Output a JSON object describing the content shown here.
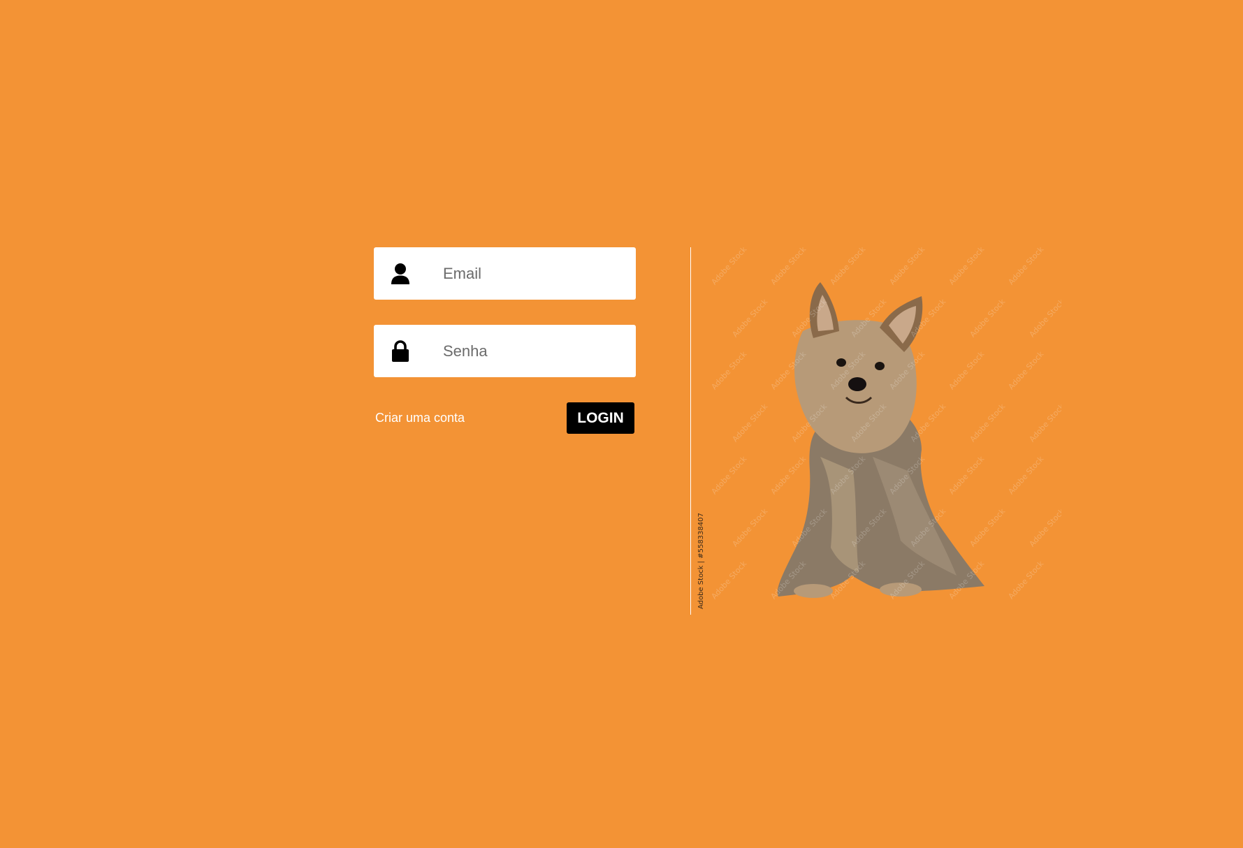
{
  "login_form": {
    "email": {
      "placeholder": "Email",
      "icon": "user-icon"
    },
    "password": {
      "placeholder": "Senha",
      "icon": "lock-icon"
    },
    "create_account_label": "Criar uma conta",
    "login_label": "LOGIN"
  },
  "image": {
    "subject": "yorkshire-terrier-dog",
    "stock_credit": "Adobe Stock | #558338407",
    "watermark_text": "Adobe Stock"
  },
  "colors": {
    "background": "#f39335",
    "field_background": "#ffffff",
    "button_background": "#000000",
    "button_text": "#ffffff",
    "link_text": "#ffffff"
  }
}
